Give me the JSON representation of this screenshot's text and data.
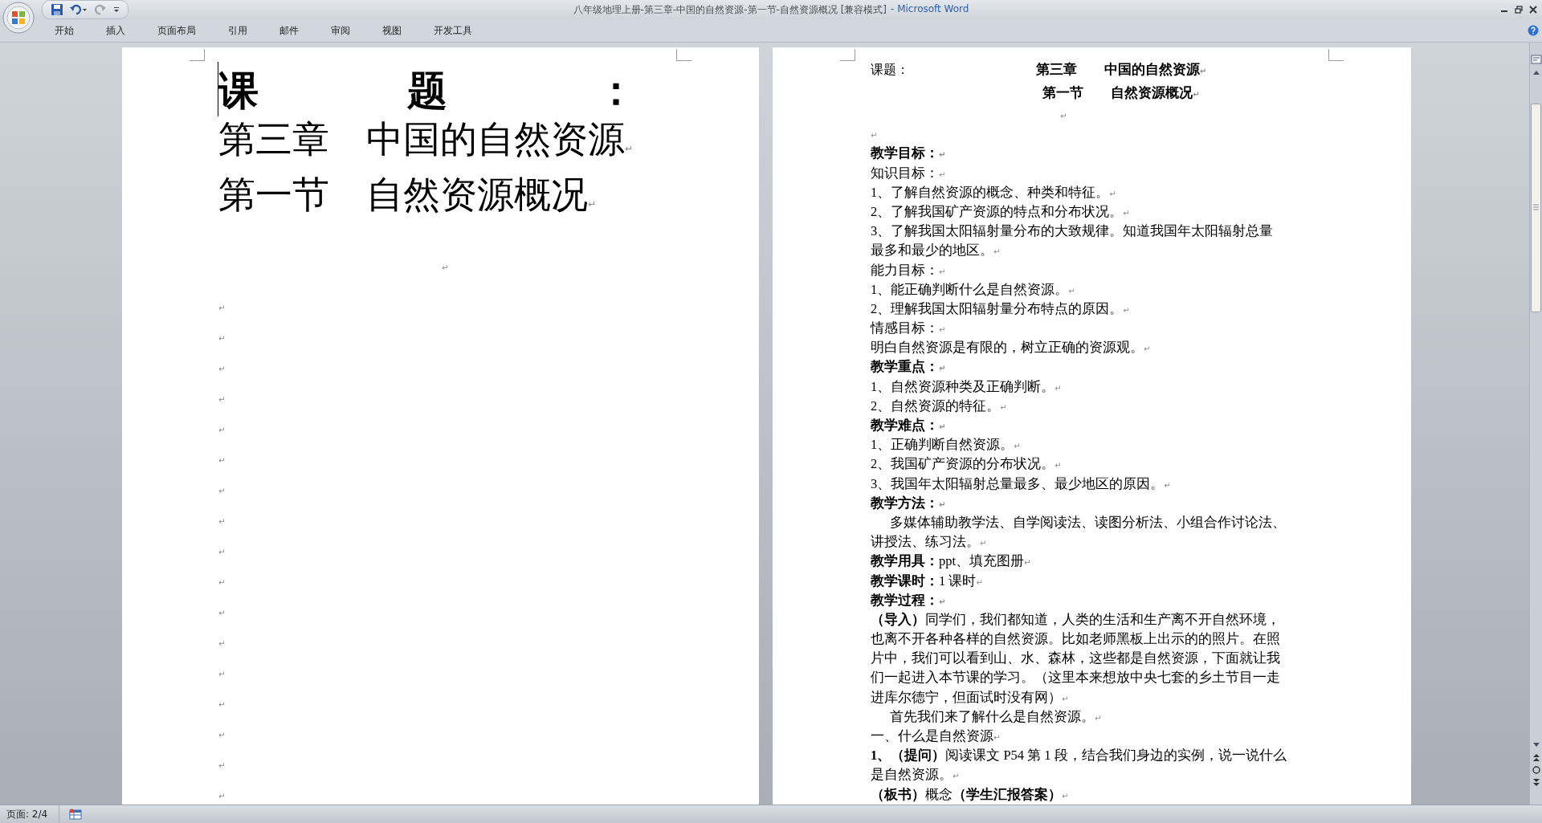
{
  "window": {
    "title": "八年级地理上册-第三章-中国的自然资源-第一节-自然资源概况 [兼容模式]",
    "app": "- Microsoft Word"
  },
  "tabs": [
    {
      "label": "开始",
      "selected": false
    },
    {
      "label": "插入",
      "selected": false
    },
    {
      "label": "页面布局",
      "selected": false
    },
    {
      "label": "引用",
      "selected": false
    },
    {
      "label": "邮件",
      "selected": false
    },
    {
      "label": "审阅",
      "selected": false
    },
    {
      "label": "视图",
      "selected": false
    },
    {
      "label": "开发工具",
      "selected": false
    }
  ],
  "paragraph_mark": "↵",
  "left_page": {
    "heading": "课 题 ：",
    "titles": [
      {
        "text": "第三章　中国的自然资源",
        "mark": true
      },
      {
        "text": "第一节　自然资源概况",
        "mark": true
      }
    ],
    "blank_paragraphs": [
      {
        "kind": "center",
        "mark": true
      },
      {
        "kind": "left",
        "mark": true
      },
      {
        "kind": "left",
        "mark": true
      },
      {
        "kind": "left",
        "mark": true
      },
      {
        "kind": "left",
        "mark": true
      },
      {
        "kind": "left",
        "mark": true
      },
      {
        "kind": "left",
        "mark": true
      },
      {
        "kind": "left",
        "mark": true
      },
      {
        "kind": "left",
        "mark": true
      },
      {
        "kind": "left",
        "mark": true
      },
      {
        "kind": "left",
        "mark": true
      },
      {
        "kind": "left",
        "mark": true
      },
      {
        "kind": "left",
        "mark": true
      },
      {
        "kind": "left",
        "mark": true
      },
      {
        "kind": "left",
        "mark": true
      },
      {
        "kind": "left",
        "mark": true
      },
      {
        "kind": "left",
        "mark": true
      },
      {
        "kind": "left",
        "mark": true
      }
    ]
  },
  "right_page": {
    "label": "课题：",
    "titles": [
      {
        "text": "第三章　　中国的自然资源",
        "mark": true
      },
      {
        "text": "第一节　　自然资源概况",
        "mark": true
      }
    ],
    "lines": [
      {
        "kind": "blank_center",
        "mark": true
      },
      {
        "kind": "blank",
        "mark": true
      },
      {
        "kind": "heading",
        "text": "教学目标：",
        "mark": true
      },
      {
        "kind": "body",
        "text": "知识目标：",
        "mark": true
      },
      {
        "kind": "body",
        "text": "1、了解自然资源的概念、种类和特征。",
        "mark": true
      },
      {
        "kind": "body",
        "text": "2、了解我国矿产资源的特点和分布状况。",
        "mark": true
      },
      {
        "kind": "body",
        "text": "3、了解我国太阳辐射量分布的大致规律。知道我国年太阳辐射总量",
        "mark": false
      },
      {
        "kind": "body",
        "text": "最多和最少的地区。",
        "mark": true
      },
      {
        "kind": "body",
        "text": "能力目标：",
        "mark": true
      },
      {
        "kind": "body",
        "text": "1、能正确判断什么是自然资源。",
        "mark": true
      },
      {
        "kind": "body",
        "text": "2、理解我国太阳辐射量分布特点的原因。",
        "mark": true
      },
      {
        "kind": "body",
        "text": "情感目标：",
        "mark": true
      },
      {
        "kind": "body",
        "text": "明白自然资源是有限的，树立正确的资源观。",
        "mark": true
      },
      {
        "kind": "heading",
        "text": "教学重点：",
        "mark": true
      },
      {
        "kind": "body",
        "text": "1、自然资源种类及正确判断。",
        "mark": true
      },
      {
        "kind": "body",
        "text": "2、自然资源的特征。",
        "mark": true
      },
      {
        "kind": "heading",
        "text": "教学难点：",
        "mark": true
      },
      {
        "kind": "body",
        "text": "1、正确判断自然资源。",
        "mark": true
      },
      {
        "kind": "body",
        "text": "2、我国矿产资源的分布状况。",
        "mark": true
      },
      {
        "kind": "body",
        "text": "3、我国年太阳辐射总量最多、最少地区的原因。",
        "mark": true
      },
      {
        "kind": "heading",
        "text": "教学方法：",
        "mark": true
      },
      {
        "kind": "indent",
        "text": "多媒体辅助教学法、自学阅读法、读图分析法、小组合作讨论法、",
        "mark": false
      },
      {
        "kind": "body",
        "text": "讲授法、练习法。",
        "mark": true
      },
      {
        "kind": "body",
        "text": "**教学用具：**ppt、填充图册",
        "mark": true
      },
      {
        "kind": "body",
        "text": "**教学课时：**1 课时",
        "mark": true
      },
      {
        "kind": "heading",
        "text": "教学过程：",
        "mark": true
      },
      {
        "kind": "body",
        "text": "**（导入）**同学们，我们都知道，人类的生活和生产离不开自然环境，",
        "mark": false
      },
      {
        "kind": "body",
        "text": "也离不开各种各样的自然资源。比如老师黑板上出示的的照片。在照",
        "mark": false
      },
      {
        "kind": "body",
        "text": "片中，我们可以看到山、水、森林，这些都是自然资源，下面就让我",
        "mark": false
      },
      {
        "kind": "body",
        "text": "们一起进入本节课的学习。（这里本来想放中央七套的乡土节目一走",
        "mark": false
      },
      {
        "kind": "body",
        "text": "进库尔德宁，但面试时没有网）",
        "mark": true
      },
      {
        "kind": "indent",
        "text": "首先我们来了解什么是自然资源。",
        "mark": true
      },
      {
        "kind": "body",
        "text": "一、什么是自然资源",
        "mark": true
      },
      {
        "kind": "body",
        "text": "**1、（提问）**阅读课文 P54 第 1 段，结合我们身边的实例，说一说什么",
        "mark": false
      },
      {
        "kind": "body",
        "text": "是自然资源。",
        "mark": true
      },
      {
        "kind": "body",
        "text": "**（板书）**概念**（学生汇报答案）**",
        "mark": true
      }
    ]
  },
  "status_bar": {
    "page": "页面: 2/4"
  }
}
